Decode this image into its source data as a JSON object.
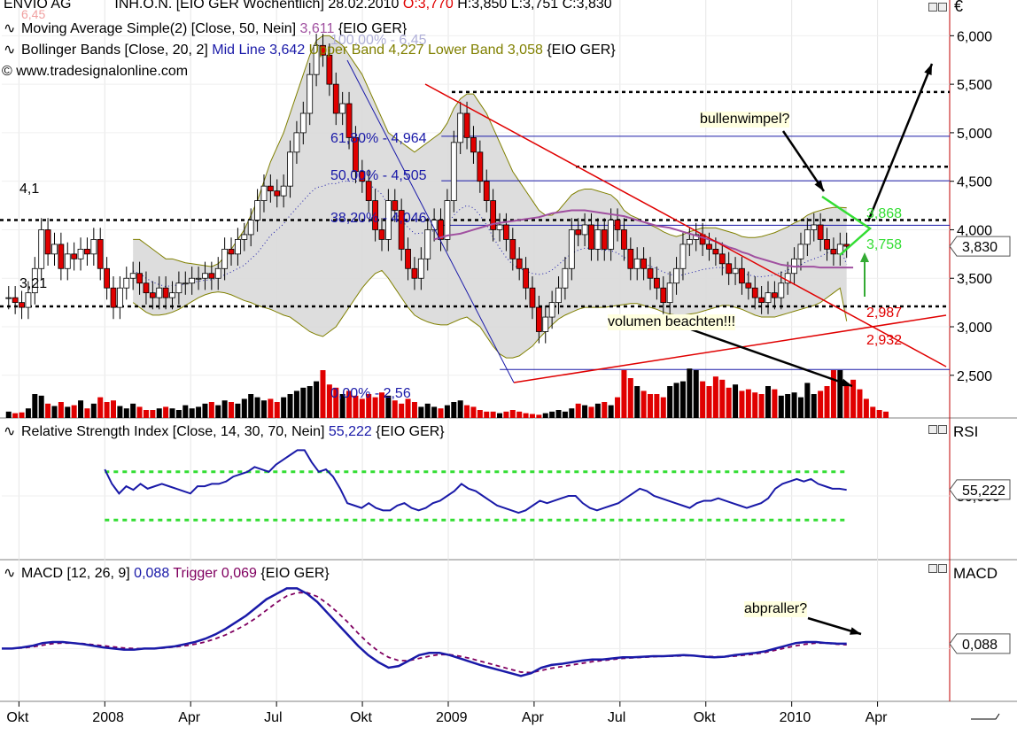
{
  "header": {
    "symbol": "ENVIO AG",
    "instrument": "INH.O.N. [EIO GER",
    "period": "Wöchentlich]",
    "date": "28.02.2010",
    "open_label": "O:3,770",
    "high_label": "H:3,850",
    "low_label": "L:3,751",
    "close_label": "C:3,830",
    "currency": "€"
  },
  "legends": {
    "ma": "Moving Average Simple(2) [Close, 50, Nein]",
    "ma_value": "3,611",
    "ma_suffix": "{EIO GER}",
    "bb_prefix": "Bollinger Bands [Close, 20, 2]",
    "bb_mid": "Mid Line 3,642",
    "bb_upper_lower": "Upper Band 4,227 Lower Band 3,058",
    "bb_suffix": "{EIO GER}",
    "copyright": "© www.tradesignalonline.com",
    "rsi_prefix": "Relative Strength Index [Close, 14, 30, 70, Nein]",
    "rsi_value": "55,222",
    "rsi_suffix": "{EIO GER}",
    "macd_prefix": "MACD [12, 26, 9]",
    "macd_value": "0,088",
    "macd_trigger": "Trigger 0,069",
    "macd_suffix": "{EIO GER}"
  },
  "panel_titles": {
    "rsi": "RSI",
    "macd": "MACD"
  },
  "annotations": {
    "fib_100": "100,00% - 6,45",
    "fib_618": "61,80% - 4,964",
    "fib_50": "50,00% - 4,505",
    "fib_382": "38,20% - 4,046",
    "fib_0": "0,00% - 2,56",
    "level_41": "4,1",
    "level_321": "3,21",
    "top_label": "6,45",
    "bullenwimpel": "bullenwimpel?",
    "volumen": "volumen beachten!!!",
    "abpraller": "abpraller?",
    "pennant_top": "3,868",
    "pennant_bottom": "3,758",
    "red_line_1": "2,987",
    "red_line_2": "2,932"
  },
  "colors": {
    "up": "#000000",
    "down": "#e00000",
    "bb_fill": "#d9d9d9",
    "bb_band": "#808000",
    "ma": "#a050a0",
    "fib": "#1a1aa8",
    "rsi": "#1a1aa8",
    "macd": "#1a1aa8",
    "trigger": "#800060",
    "pennant": "#33dd33",
    "red_line": "#e00000"
  },
  "chart_data": {
    "type": "line",
    "price_axis": {
      "ticks": [
        "6,000",
        "5,500",
        "5,000",
        "4,500",
        "4,000",
        "3,500",
        "3,000",
        "2,500"
      ],
      "values": [
        6.0,
        5.5,
        5.0,
        4.5,
        4.0,
        3.5,
        3.0,
        2.5
      ],
      "current": "3,830",
      "ylim": [
        2.06,
        6.35
      ]
    },
    "x_ticks": [
      "Okt",
      "2008",
      "Apr",
      "Jul",
      "Okt",
      "2009",
      "Apr",
      "Jul",
      "Okt",
      "2010",
      "Apr"
    ],
    "x_tick_values": [
      2007.75,
      2008.0,
      2008.25,
      2008.5,
      2008.75,
      2009.0,
      2009.25,
      2009.5,
      2009.75,
      2010.0,
      2010.25
    ],
    "xlim": [
      2007.7,
      2010.46
    ],
    "close": [
      3.3,
      3.25,
      3.2,
      3.35,
      3.6,
      4.0,
      3.75,
      3.85,
      3.6,
      3.75,
      3.7,
      3.8,
      3.75,
      3.9,
      3.6,
      3.4,
      3.2,
      3.4,
      3.5,
      3.55,
      3.45,
      3.35,
      3.3,
      3.4,
      3.3,
      3.35,
      3.45,
      3.45,
      3.5,
      3.5,
      3.55,
      3.5,
      3.6,
      3.8,
      3.75,
      3.9,
      3.95,
      4.1,
      4.3,
      4.45,
      4.4,
      4.35,
      4.45,
      4.8,
      5.0,
      5.2,
      5.6,
      5.9,
      5.8,
      5.5,
      5.2,
      5.3,
      4.95,
      4.6,
      4.5,
      4.3,
      4.0,
      3.9,
      4.3,
      4.2,
      3.8,
      3.6,
      3.5,
      3.7,
      4.0,
      4.1,
      3.9,
      4.3,
      4.9,
      5.2,
      4.95,
      4.8,
      4.5,
      4.3,
      4.0,
      4.05,
      3.9,
      3.7,
      3.6,
      3.4,
      3.2,
      2.95,
      3.1,
      3.25,
      3.4,
      3.6,
      4.0,
      3.95,
      4.05,
      3.8,
      4.0,
      3.8,
      4.1,
      4.0,
      3.8,
      3.6,
      3.7,
      3.6,
      3.5,
      3.4,
      3.25,
      3.45,
      3.6,
      3.85,
      3.9,
      3.95,
      3.85,
      3.8,
      3.75,
      3.65,
      3.55,
      3.6,
      3.45,
      3.4,
      3.3,
      3.25,
      3.35,
      3.3,
      3.45,
      3.55,
      3.7,
      3.85,
      4.0,
      4.05,
      3.9,
      3.8,
      3.75,
      3.85,
      3.83
    ],
    "bb_upper": [
      null,
      null,
      null,
      null,
      null,
      null,
      null,
      null,
      null,
      null,
      null,
      null,
      null,
      null,
      null,
      null,
      null,
      null,
      null,
      3.9,
      3.9,
      3.85,
      3.8,
      3.75,
      3.7,
      3.7,
      3.68,
      3.66,
      3.65,
      3.64,
      3.63,
      3.62,
      3.65,
      3.72,
      3.8,
      3.9,
      4.0,
      4.15,
      4.3,
      4.5,
      4.7,
      4.85,
      5.0,
      5.2,
      5.4,
      5.6,
      5.8,
      5.95,
      6.0,
      6.0,
      5.95,
      5.9,
      5.8,
      5.7,
      5.6,
      5.45,
      5.3,
      5.15,
      5.0,
      4.95,
      4.9,
      4.85,
      4.8,
      4.85,
      4.9,
      4.95,
      5.0,
      5.1,
      5.25,
      5.35,
      5.4,
      5.4,
      5.3,
      5.2,
      5.05,
      4.9,
      4.75,
      4.6,
      4.5,
      4.4,
      4.3,
      4.2,
      4.15,
      4.15,
      4.2,
      4.28,
      4.36,
      4.4,
      4.42,
      4.42,
      4.4,
      4.38,
      4.36,
      4.3,
      4.2,
      4.15,
      4.12,
      4.08,
      4.05,
      4.02,
      3.98,
      3.95,
      3.93,
      3.95,
      3.98,
      4.0,
      4.02,
      4.02,
      4.02,
      4.0,
      3.98,
      3.96,
      3.93,
      3.92,
      3.92,
      3.93,
      3.95,
      3.97,
      4.0,
      4.03,
      4.07,
      4.1,
      4.15,
      4.18,
      4.2,
      4.22,
      4.23,
      4.23,
      4.227
    ],
    "bb_lower": [
      null,
      null,
      null,
      null,
      null,
      null,
      null,
      null,
      null,
      null,
      null,
      null,
      null,
      null,
      null,
      null,
      null,
      null,
      null,
      3.25,
      3.2,
      3.15,
      3.12,
      3.12,
      3.13,
      3.15,
      3.18,
      3.22,
      3.26,
      3.3,
      3.33,
      3.35,
      3.36,
      3.35,
      3.33,
      3.3,
      3.27,
      3.25,
      3.22,
      3.2,
      3.18,
      3.15,
      3.12,
      3.1,
      3.05,
      3.0,
      2.95,
      2.92,
      2.9,
      2.95,
      3.0,
      3.1,
      3.2,
      3.3,
      3.4,
      3.48,
      3.55,
      3.58,
      3.5,
      3.4,
      3.3,
      3.2,
      3.12,
      3.08,
      3.05,
      3.03,
      3.02,
      3.02,
      3.05,
      3.08,
      3.1,
      3.05,
      3.0,
      2.9,
      2.8,
      2.72,
      2.68,
      2.68,
      2.7,
      2.75,
      2.8,
      2.88,
      2.95,
      3.02,
      3.08,
      3.12,
      3.15,
      3.18,
      3.2,
      3.2,
      3.2,
      3.2,
      3.21,
      3.22,
      3.23,
      3.24,
      3.24,
      3.22,
      3.2,
      3.18,
      3.15,
      3.13,
      3.12,
      3.12,
      3.13,
      3.14,
      3.16,
      3.18,
      3.2,
      3.22,
      3.22,
      3.2,
      3.18,
      3.15,
      3.12,
      3.1,
      3.1,
      3.1,
      3.12,
      3.14,
      3.16,
      3.18,
      3.2,
      3.22,
      3.25,
      3.3,
      3.35,
      3.4,
      3.058
    ],
    "ma": [
      null,
      null,
      null,
      null,
      null,
      null,
      null,
      null,
      null,
      null,
      null,
      null,
      null,
      null,
      null,
      null,
      null,
      null,
      null,
      null,
      null,
      null,
      null,
      null,
      null,
      null,
      null,
      null,
      null,
      null,
      null,
      null,
      null,
      null,
      null,
      null,
      null,
      null,
      null,
      null,
      null,
      null,
      null,
      null,
      null,
      null,
      null,
      null,
      null,
      null,
      3.9,
      3.92,
      3.94,
      3.95,
      3.96,
      3.98,
      4.0,
      4.02,
      4.04,
      4.06,
      4.07,
      4.08,
      4.09,
      4.1,
      4.11,
      4.12,
      4.13,
      4.15,
      4.17,
      4.18,
      4.19,
      4.2,
      4.2,
      4.2,
      4.19,
      4.18,
      4.17,
      4.16,
      4.15,
      4.14,
      4.12,
      4.1,
      4.08,
      4.06,
      4.04,
      4.03,
      4.02,
      4.0,
      3.98,
      3.96,
      3.94,
      3.92,
      3.9,
      3.88,
      3.85,
      3.82,
      3.8,
      3.77,
      3.75,
      3.72,
      3.7,
      3.68,
      3.66,
      3.64,
      3.63,
      3.62,
      3.62,
      3.62,
      3.62,
      3.61,
      3.61,
      3.61,
      3.61,
      3.61,
      3.61
    ],
    "volume": [
      8,
      6,
      7,
      12,
      30,
      28,
      18,
      15,
      20,
      14,
      16,
      22,
      12,
      18,
      26,
      20,
      22,
      15,
      12,
      18,
      14,
      10,
      10,
      12,
      14,
      12,
      10,
      16,
      12,
      14,
      18,
      20,
      16,
      22,
      20,
      18,
      24,
      30,
      26,
      22,
      24,
      20,
      26,
      30,
      34,
      38,
      40,
      46,
      60,
      42,
      38,
      30,
      34,
      28,
      24,
      30,
      26,
      32,
      28,
      22,
      18,
      24,
      20,
      14,
      18,
      14,
      12,
      16,
      20,
      22,
      16,
      14,
      10,
      8,
      8,
      6,
      8,
      10,
      8,
      6,
      5,
      4,
      6,
      8,
      10,
      8,
      12,
      18,
      16,
      14,
      18,
      20,
      16,
      26,
      60,
      50,
      40,
      34,
      30,
      30,
      26,
      40,
      44,
      46,
      62,
      60,
      46,
      40,
      52,
      48,
      38,
      42,
      34,
      36,
      32,
      30,
      40,
      36,
      28,
      30,
      32,
      26,
      44,
      30,
      34,
      40,
      60,
      60,
      44,
      48,
      36,
      24,
      14,
      10,
      8
    ],
    "fib_levels": [
      {
        "label": "100,00% - 6,45",
        "value": 6.45
      },
      {
        "label": "61,80% - 4,964",
        "value": 4.964
      },
      {
        "label": "50,00% - 4,505",
        "value": 4.505
      },
      {
        "label": "38,20% - 4,046",
        "value": 4.046
      },
      {
        "label": "0,00% - 2,56",
        "value": 2.56
      }
    ],
    "rsi": {
      "value": "55,222",
      "ticks": [
        "50,000"
      ],
      "ylim": [
        0,
        100
      ],
      "levels": [
        70,
        30
      ],
      "values": [
        72,
        60,
        52,
        58,
        55,
        60,
        56,
        58,
        60,
        58,
        56,
        54,
        52,
        58,
        58,
        60,
        60,
        62,
        66,
        68,
        70,
        74,
        72,
        70,
        76,
        80,
        84,
        88,
        88,
        78,
        70,
        72,
        66,
        56,
        44,
        42,
        40,
        44,
        40,
        38,
        38,
        42,
        44,
        40,
        38,
        40,
        44,
        46,
        50,
        54,
        60,
        56,
        54,
        50,
        46,
        42,
        40,
        38,
        36,
        38,
        42,
        46,
        44,
        46,
        48,
        50,
        50,
        44,
        40,
        38,
        40,
        42,
        44,
        48,
        52,
        56,
        54,
        50,
        48,
        46,
        44,
        42,
        40,
        44,
        46,
        46,
        48,
        46,
        44,
        42,
        40,
        42,
        44,
        48,
        56,
        60,
        62,
        64,
        62,
        64,
        60,
        58,
        56,
        56,
        55
      ]
    },
    "macd": {
      "value": "0,088",
      "trigger_value": "0,069",
      "ylim": [
        -0.9,
        1.3
      ],
      "macd": [
        0.0,
        0.0,
        0.02,
        0.05,
        0.1,
        0.12,
        0.12,
        0.1,
        0.08,
        0.05,
        0.02,
        0.0,
        -0.02,
        -0.02,
        0.0,
        0.0,
        0.02,
        0.04,
        0.08,
        0.12,
        0.18,
        0.26,
        0.36,
        0.48,
        0.6,
        0.75,
        0.9,
        1.0,
        1.1,
        1.1,
        1.0,
        0.85,
        0.65,
        0.45,
        0.25,
        0.05,
        -0.12,
        -0.25,
        -0.35,
        -0.32,
        -0.22,
        -0.12,
        -0.08,
        -0.08,
        -0.12,
        -0.18,
        -0.24,
        -0.3,
        -0.35,
        -0.4,
        -0.45,
        -0.5,
        -0.45,
        -0.35,
        -0.3,
        -0.28,
        -0.25,
        -0.22,
        -0.2,
        -0.2,
        -0.18,
        -0.16,
        -0.16,
        -0.15,
        -0.14,
        -0.14,
        -0.13,
        -0.12,
        -0.13,
        -0.15,
        -0.16,
        -0.15,
        -0.12,
        -0.1,
        -0.08,
        -0.05,
        0.0,
        0.05,
        0.1,
        0.12,
        0.12,
        0.1,
        0.09,
        0.088
      ],
      "trigger": [
        0.0,
        0.0,
        0.01,
        0.03,
        0.06,
        0.09,
        0.1,
        0.1,
        0.09,
        0.07,
        0.05,
        0.03,
        0.01,
        0.0,
        0.0,
        0.0,
        0.01,
        0.03,
        0.05,
        0.08,
        0.12,
        0.18,
        0.25,
        0.34,
        0.44,
        0.56,
        0.7,
        0.84,
        0.96,
        1.02,
        1.02,
        0.95,
        0.82,
        0.66,
        0.48,
        0.28,
        0.1,
        -0.05,
        -0.16,
        -0.22,
        -0.22,
        -0.18,
        -0.14,
        -0.11,
        -0.11,
        -0.14,
        -0.18,
        -0.23,
        -0.28,
        -0.33,
        -0.38,
        -0.43,
        -0.44,
        -0.4,
        -0.36,
        -0.33,
        -0.3,
        -0.27,
        -0.24,
        -0.22,
        -0.2,
        -0.18,
        -0.17,
        -0.16,
        -0.15,
        -0.14,
        -0.14,
        -0.13,
        -0.13,
        -0.14,
        -0.15,
        -0.15,
        -0.14,
        -0.12,
        -0.1,
        -0.07,
        -0.03,
        0.01,
        0.05,
        0.08,
        0.1,
        0.1,
        0.08,
        0.069
      ]
    }
  }
}
